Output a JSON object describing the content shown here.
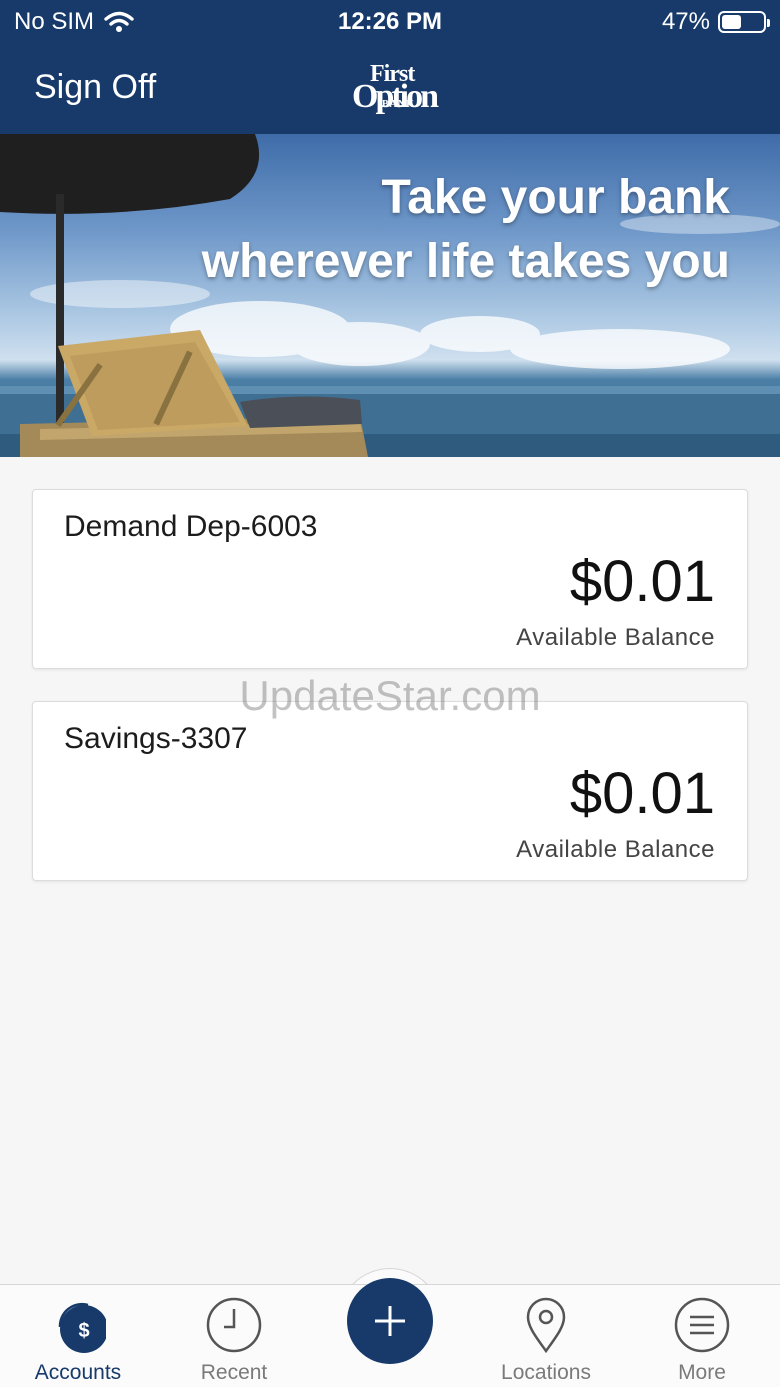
{
  "status_bar": {
    "carrier": "No SIM",
    "time": "12:26 PM",
    "battery_percent": "47%",
    "battery_level": 0.47
  },
  "header": {
    "sign_off_label": "Sign Off",
    "logo": {
      "line1": "First",
      "line2": "Option",
      "line3": "BANK"
    }
  },
  "hero": {
    "line1": "Take your bank",
    "line2": "wherever life takes you"
  },
  "accounts": [
    {
      "name": "Demand Dep-6003",
      "balance": "$0.01",
      "balance_label": "Available Balance"
    },
    {
      "name": "Savings-3307",
      "balance": "$0.01",
      "balance_label": "Available Balance"
    }
  ],
  "watermark": "UpdateStar.com",
  "tabs": [
    {
      "label": "Accounts",
      "icon": "accounts-icon",
      "active": true
    },
    {
      "label": "Recent",
      "icon": "clock-icon",
      "active": false
    },
    {
      "label": "",
      "icon": "plus-icon",
      "active": false
    },
    {
      "label": "Locations",
      "icon": "location-pin-icon",
      "active": false
    },
    {
      "label": "More",
      "icon": "menu-icon",
      "active": false
    }
  ],
  "colors": {
    "brand": "#173a6b",
    "background": "#f6f6f6",
    "inactive_tab": "#7a7a7a"
  }
}
